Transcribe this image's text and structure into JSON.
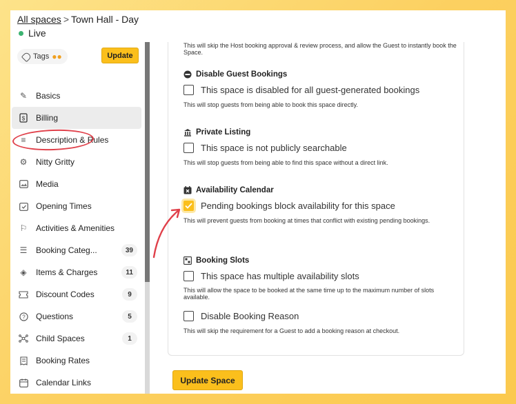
{
  "breadcrumb": {
    "root": "All spaces",
    "separator": ">",
    "current": "Town Hall - Day"
  },
  "status": {
    "label": "Live",
    "color": "#3cb371"
  },
  "sidebar": {
    "tags_label": "Tags",
    "update_label": "Update",
    "items": [
      {
        "label": "Basics",
        "icon": "pencil-icon"
      },
      {
        "label": "Billing",
        "icon": "dollar-doc-icon",
        "active": true
      },
      {
        "label": "Description & Rules",
        "icon": "lines-icon"
      },
      {
        "label": "Nitty Gritty",
        "icon": "gears-icon"
      },
      {
        "label": "Media",
        "icon": "image-icon"
      },
      {
        "label": "Opening Times",
        "icon": "calendar-check-icon"
      },
      {
        "label": "Activities & Amenities",
        "icon": "activity-icon"
      },
      {
        "label": "Booking Categ...",
        "icon": "list-icon",
        "count": "39"
      },
      {
        "label": "Items & Charges",
        "icon": "layers-icon",
        "count": "11"
      },
      {
        "label": "Discount Codes",
        "icon": "ticket-icon",
        "count": "9"
      },
      {
        "label": "Questions",
        "icon": "question-icon",
        "count": "5"
      },
      {
        "label": "Child Spaces",
        "icon": "nodes-icon",
        "count": "1"
      },
      {
        "label": "Booking Rates",
        "icon": "receipt-icon"
      },
      {
        "label": "Calendar Links",
        "icon": "calendar-icon"
      }
    ]
  },
  "main": {
    "intro_text": "This will skip the Host booking approval & review process, and allow the Guest to instantly book the Space.",
    "sections": [
      {
        "title": "Disable Guest Bookings",
        "icon": "block-icon",
        "checkbox_label": "This space is disabled for all guest-generated bookings",
        "checked": false,
        "help": "This will stop guests from being able to book this space directly."
      },
      {
        "title": "Private Listing",
        "icon": "building-icon",
        "checkbox_label": "This space is not publicly searchable",
        "checked": false,
        "help": "This will stop guests from being able to find this space without a direct link."
      },
      {
        "title": "Availability Calendar",
        "icon": "calendar-x-icon",
        "checkbox_label": "Pending bookings block availability for this space",
        "checked": true,
        "help": "This will prevent guests from booking at times that conflict with existing pending bookings."
      },
      {
        "title": "Booking Slots",
        "icon": "slots-icon",
        "checkbox_label": "This space has multiple availability slots",
        "checked": false,
        "help": "This will allow the space to be booked at the same time up to the maximum number of slots available."
      },
      {
        "title": "",
        "icon": "",
        "checkbox_label": "Disable Booking Reason",
        "checked": false,
        "help": "This will skip the requirement for a Guest to add a booking reason at checkout."
      }
    ],
    "update_space_label": "Update Space"
  },
  "colors": {
    "accent": "#fbbf1c",
    "annotation": "#e0404a",
    "background": "#fcd060"
  }
}
